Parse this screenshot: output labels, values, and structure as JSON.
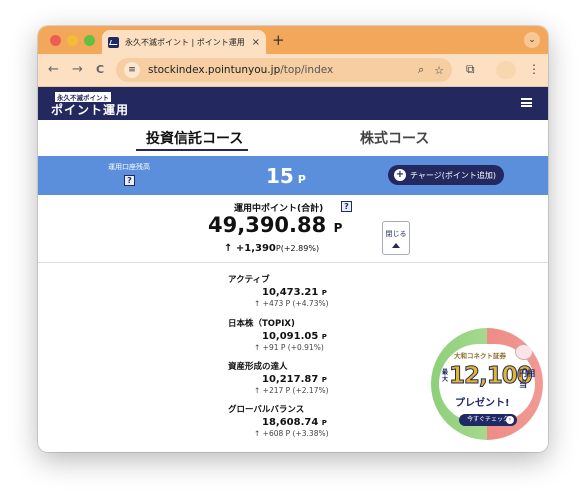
{
  "browser": {
    "tab_title": "永久不滅ポイント | ポイント運用",
    "tab_close": "×",
    "new_tab": "+",
    "tab_menu": "⌄",
    "back": "←",
    "forward": "→",
    "reload": "C",
    "url_host": "stockindex.pointunyou.jp",
    "url_path": "/top/index",
    "zoom_icon": "⌕",
    "star_icon": "☆",
    "ext_icon": "⧉",
    "more_icon": "⋮"
  },
  "site": {
    "logo_small": "永久不滅ポイント",
    "logo_main": "ポイント運用"
  },
  "course_tabs": [
    {
      "label": "投資信託コース",
      "active": true
    },
    {
      "label": "株式コース",
      "active": false
    }
  ],
  "account": {
    "label": "運用口座残高",
    "help": "?",
    "balance": "15",
    "unit": "P",
    "charge_label": "チャージ(ポイント追加)",
    "charge_icon": "+"
  },
  "summary": {
    "label": "運用中ポイント(合計)",
    "help": "?",
    "total": "49,390.88",
    "unit": "P",
    "change_arrow": "↑",
    "change_value": "+1,390",
    "change_detail": "P(+2.89%)",
    "close_label": "閉じる"
  },
  "funds": [
    {
      "name": "アクティブ",
      "value": "10,473.21",
      "unit": "P",
      "change": "↑ +473 P (+4.73%)"
    },
    {
      "name": "日本株（TOPIX)",
      "value": "10,091.05",
      "unit": "P",
      "change": "↑ +91 P (+0.91%)"
    },
    {
      "name": "資産形成の達人",
      "value": "10,217.87",
      "unit": "P",
      "change": "↑ +217 P (+2.17%)"
    },
    {
      "name": "グローバルバランス",
      "value": "18,608.74",
      "unit": "P",
      "change": "↑ +608 P (+3.38%)"
    }
  ],
  "promo": {
    "brand": "大和コネクト証券",
    "max": "最大",
    "amount": "12,100",
    "yen": "円相当",
    "present": "プレゼント!",
    "button": "今すぐチェック",
    "button_arrow": "›"
  },
  "colors": {
    "browser_accent": "#f3a75b",
    "site_navy": "#23285e",
    "balance_bar": "#5b8fdb"
  }
}
